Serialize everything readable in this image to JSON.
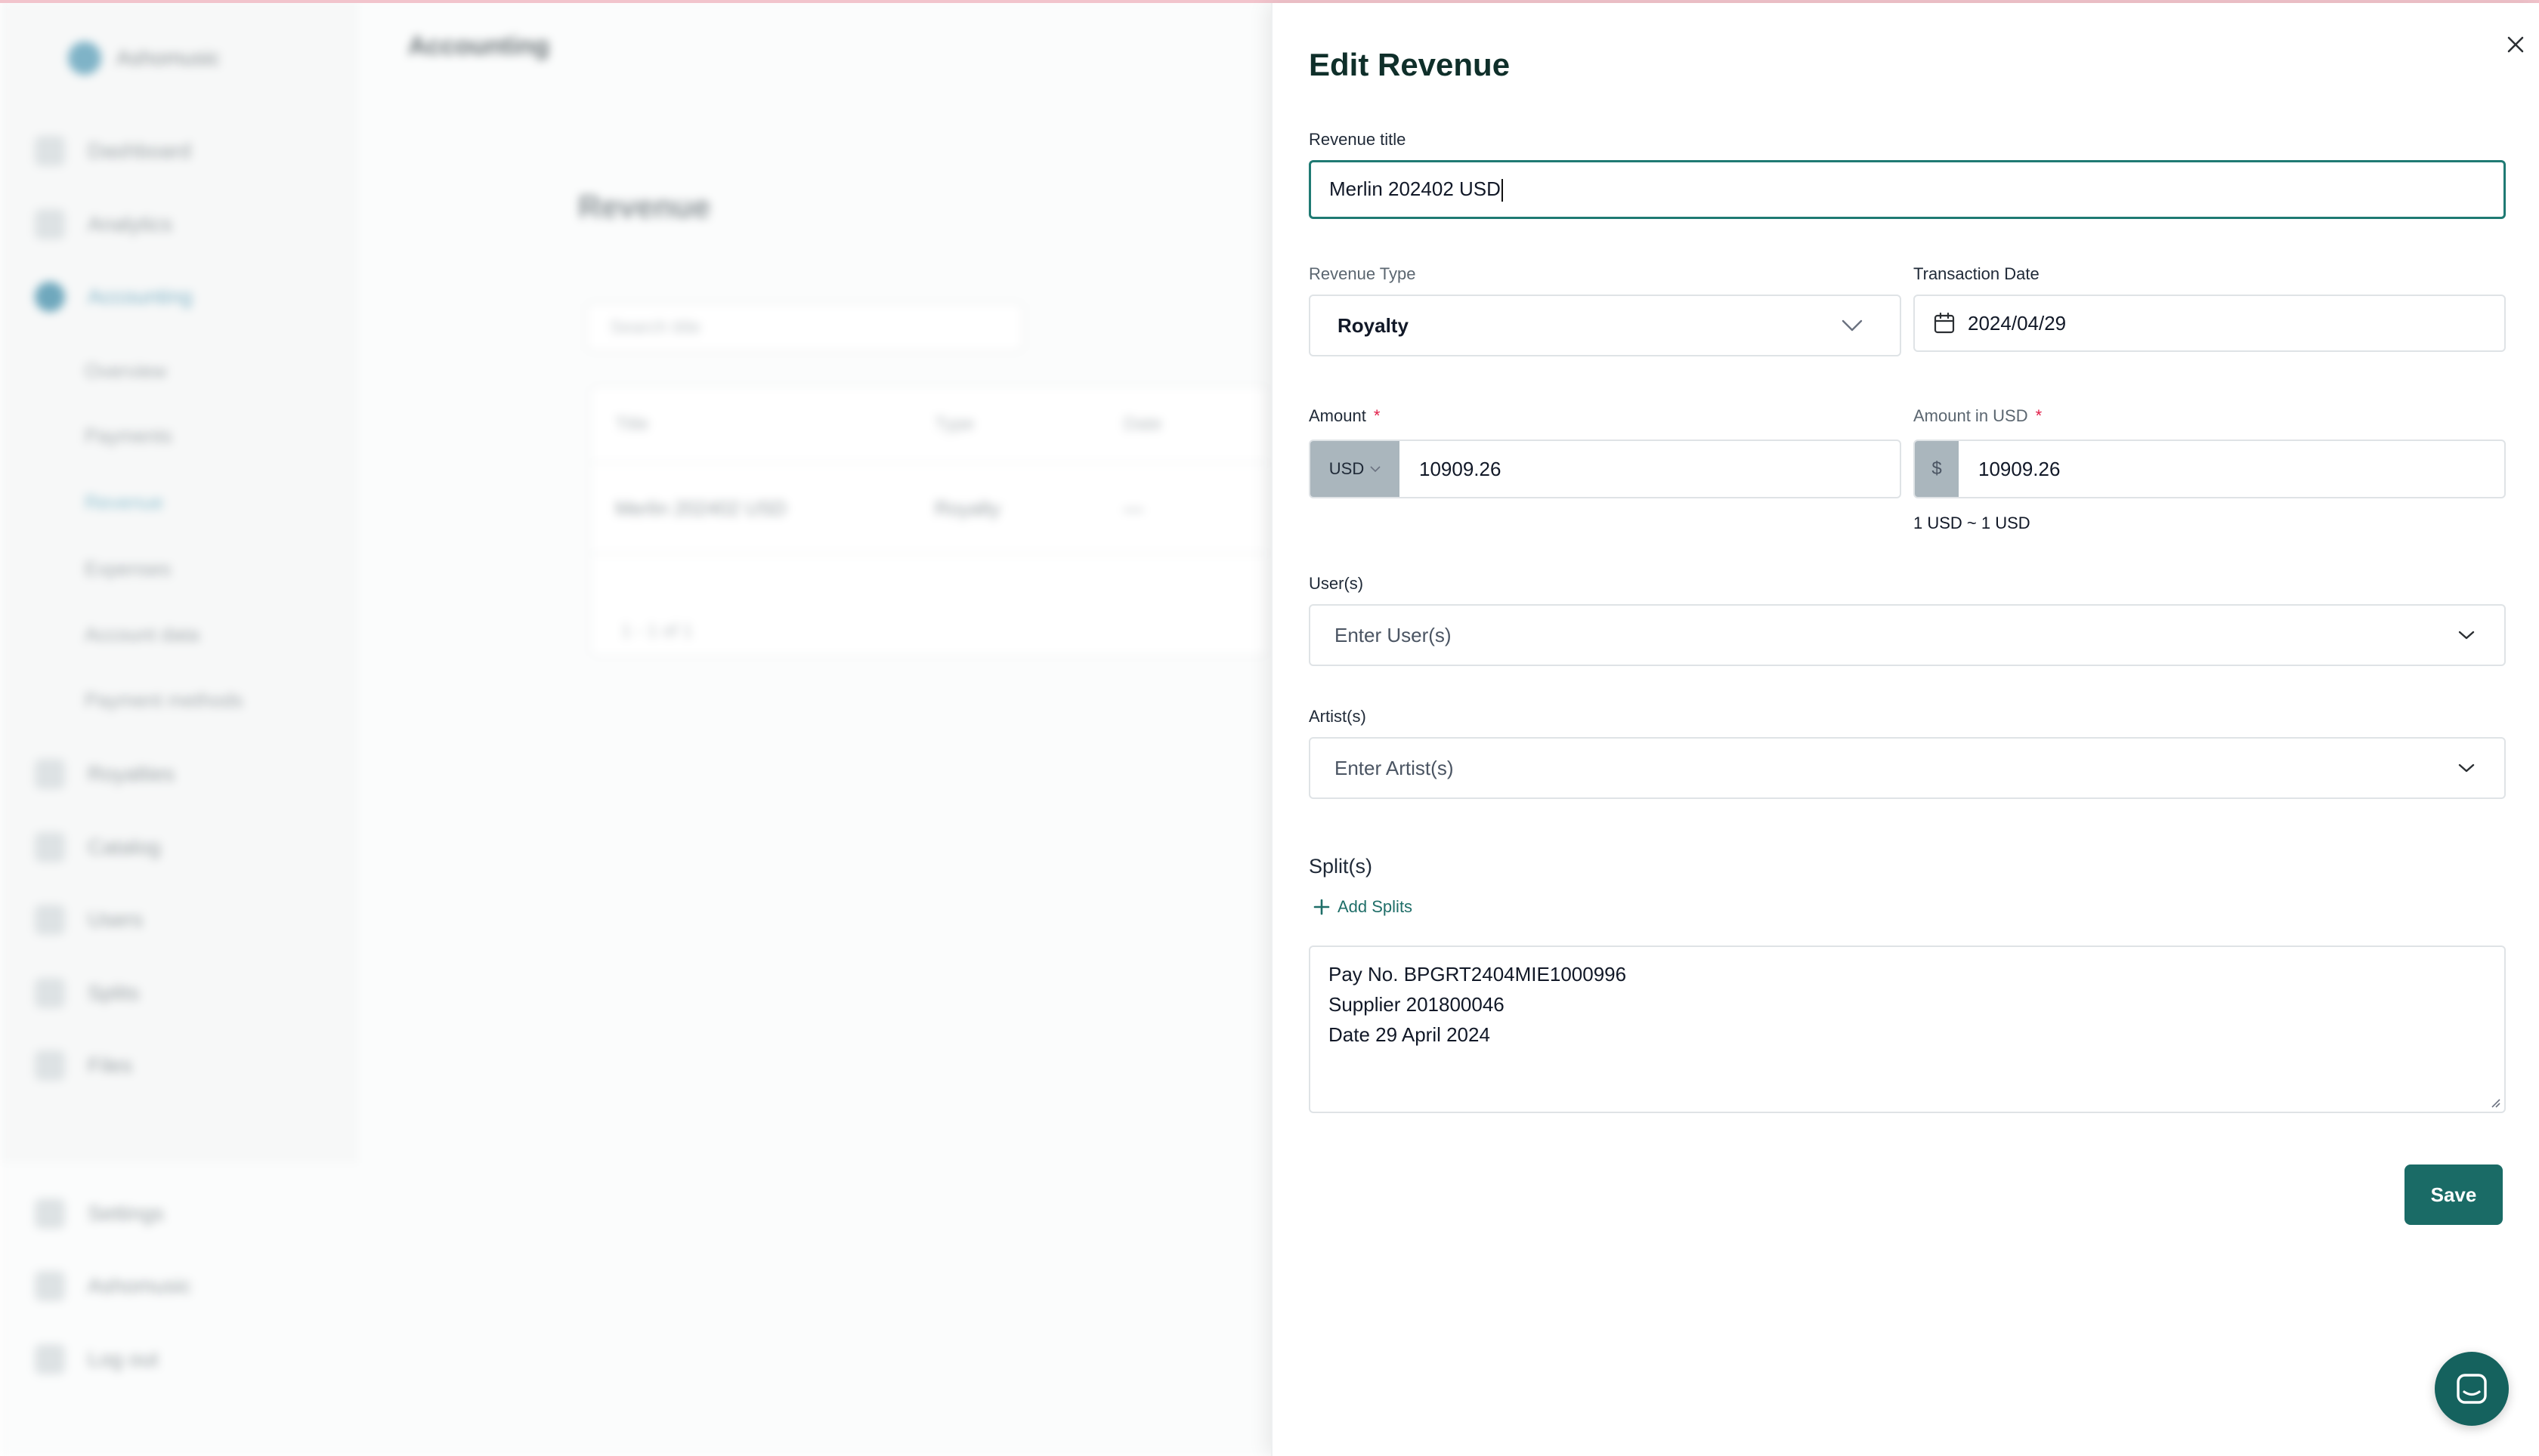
{
  "background": {
    "workspace_name": "Ashomusic",
    "header_title": "Accounting",
    "page_title": "Revenue",
    "search_placeholder": "Search title",
    "nav": [
      {
        "label": "Dashboard",
        "icon": "dashboard-icon"
      },
      {
        "label": "Analytics",
        "icon": "analytics-icon"
      },
      {
        "label": "Accounting",
        "icon": "accounting-icon",
        "active": true
      },
      {
        "label": "Royalties",
        "icon": "royalties-icon"
      },
      {
        "label": "Catalog",
        "icon": "catalog-icon"
      },
      {
        "label": "Users",
        "icon": "users-icon"
      },
      {
        "label": "Splits",
        "icon": "splits-icon"
      },
      {
        "label": "Files",
        "icon": "files-icon"
      }
    ],
    "subnav": [
      "Overview",
      "Payments",
      "Revenue",
      "Expenses",
      "Account data",
      "Payment methods"
    ],
    "bottom_nav": [
      "Settings",
      "Ashomusic",
      "Log out"
    ],
    "table_headers": [
      "Title",
      "Type",
      "Date"
    ],
    "table_row": [
      "Merlin 202402 USD",
      "Royalty",
      "—"
    ],
    "pagination": "1 - 1 of 1"
  },
  "drawer": {
    "title": "Edit Revenue",
    "revenue_title_label": "Revenue title",
    "revenue_title_value": "Merlin 202402 USD",
    "revenue_type_label": "Revenue Type",
    "revenue_type_value": "Royalty",
    "transaction_date_label": "Transaction Date",
    "transaction_date_value": "2024/04/29",
    "amount_label": "Amount",
    "amount_currency": "USD",
    "amount_value": "10909.26",
    "amount_usd_label": "Amount in USD",
    "amount_usd_symbol": "$",
    "amount_usd_value": "10909.26",
    "rate_note": "1 USD ~ 1 USD",
    "users_label": "User(s)",
    "users_placeholder": "Enter User(s)",
    "artists_label": "Artist(s)",
    "artists_placeholder": "Enter Artist(s)",
    "splits_label": "Split(s)",
    "add_splits_label": "Add Splits",
    "notes_lines": [
      "Pay No. BPGRT2404MIE1000996",
      "Supplier 201800046",
      "Date 29 April 2024"
    ],
    "save_label": "Save",
    "required_mark": "*"
  },
  "colors": {
    "accent": "#1a6b66",
    "focus_border": "#1f7a73",
    "title_text": "#0f2f2a",
    "required": "#e11d48",
    "addon_bg": "#aab6bd"
  }
}
